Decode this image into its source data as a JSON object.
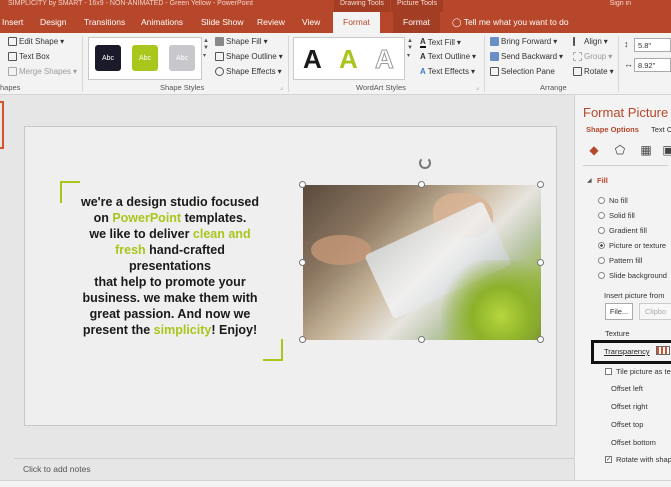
{
  "window": {
    "title": "SIMPLICITY by SMART - 16x9 - NON-ANIMATED - Green Yellow - PowerPoint",
    "contextual_drawing": "Drawing Tools",
    "contextual_picture": "Picture Tools",
    "sign_in": "Sign in"
  },
  "tabs": [
    "Insert",
    "Design",
    "Transitions",
    "Animations",
    "Slide Show",
    "Review",
    "View",
    "Format",
    "Format"
  ],
  "tell_me": "Tell me what you want to do",
  "ribbon": {
    "insert_shapes": {
      "edit_shape": "Edit Shape",
      "text_box": "Text Box",
      "merge_shapes": "Merge Shapes",
      "label": "hapes"
    },
    "shape_styles": {
      "swatches": [
        "Abc",
        "Abc",
        "Abc"
      ],
      "shape_fill": "Shape Fill",
      "shape_outline": "Shape Outline",
      "shape_effects": "Shape Effects",
      "label": "Shape Styles"
    },
    "wordart": {
      "letters": [
        "A",
        "A",
        "A"
      ],
      "text_fill": "Text Fill",
      "text_outline": "Text Outline",
      "text_effects": "Text Effects",
      "label": "WordArt Styles"
    },
    "arrange": {
      "bring_forward": "Bring Forward",
      "send_backward": "Send Backward",
      "selection_pane": "Selection Pane",
      "align": "Align",
      "group": "Group",
      "rotate": "Rotate",
      "label": "Arrange"
    },
    "size": {
      "height": "5.8\"",
      "width": "8.92\""
    }
  },
  "slide": {
    "line1": "we're a design studio focused",
    "line2_pre": "on ",
    "line2_hl": "PowerPoint",
    "line2_post": " templates.",
    "line3_pre": "we like to deliver ",
    "line3_hl": "clean and",
    "line4_hl": "fresh",
    "line4_post": " hand-crafted",
    "line5": "presentations",
    "line6": "that help to promote your",
    "line7": "business. we make them with",
    "line8": "great passion. And now we",
    "line9_pre": "present the ",
    "line9_hl": "simplicity",
    "line9_post": "! Enjoy!"
  },
  "notes_placeholder": "Click to add notes",
  "pane": {
    "title": "Format Picture",
    "tab_shape": "Shape Options",
    "tab_text": "Text O",
    "fill_section": "Fill",
    "fill_options": [
      "No fill",
      "Solid fill",
      "Gradient fill",
      "Picture or texture",
      "Pattern fill",
      "Slide background"
    ],
    "insert_picture_from": "Insert picture from",
    "file_button": "File...",
    "clipboard_button": "Clipbo",
    "texture": "Texture",
    "transparency": "Transparency",
    "tile_picture": "Tile picture as te",
    "offset_left": "Offset left",
    "offset_right": "Offset right",
    "offset_top": "Offset top",
    "offset_bottom": "Offset bottom",
    "rotate_with_shape": "Rotate with shap"
  },
  "colors": {
    "accent": "#b7472a",
    "highlight": "#a8c61b"
  }
}
